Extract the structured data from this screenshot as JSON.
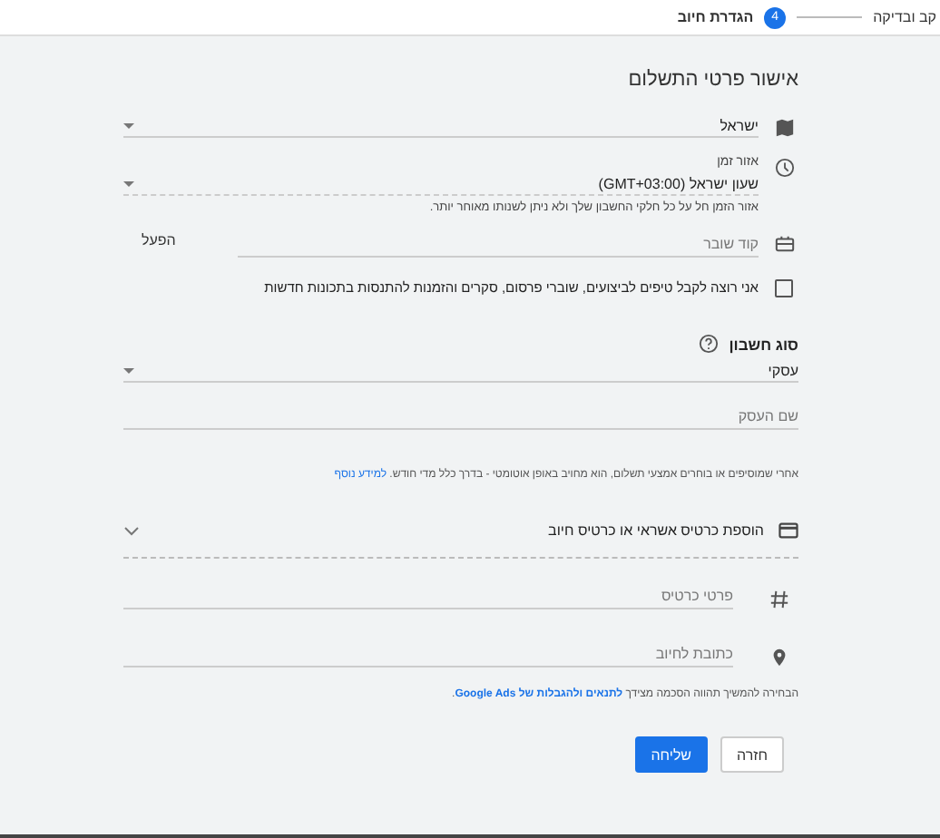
{
  "stepper": {
    "steps": [
      {
        "label": "קב ובדיקה",
        "selected": false
      },
      {
        "label": "הגדרת חיוב",
        "number": "4",
        "selected": true
      }
    ]
  },
  "title": "אישור פרטי התשלום",
  "country": {
    "value": "ישראל"
  },
  "timezone": {
    "label": "אזור זמן",
    "value": "שעון ישראל (GMT+03:00)",
    "help": "אזור הזמן חל על כל חלקי החשבון שלך ולא ניתן לשנותו מאוחר יותר."
  },
  "promo": {
    "placeholder": "קוד שובר",
    "button": "הפעל"
  },
  "tips_checkbox": {
    "label": "אני רוצה לקבל טיפים לביצועים, שוברי פרסום, סקרים והזמנות להתנסות בתכונות חדשות",
    "checked": false
  },
  "account_type": {
    "label": "סוג חשבון",
    "value": "עסקי"
  },
  "business_name": {
    "placeholder": "שם העסק"
  },
  "payment_note": {
    "text": "אחרי שמוסיפים או בוחרים אמצעי תשלום, הוא מחויב באופן אוטומטי - בדרך כלל מדי חודש.",
    "link": "למידע נוסף"
  },
  "card_section": {
    "title": "הוספת כרטיס אשראי או כרטיס חיוב",
    "expanded": true
  },
  "card_fields": [
    {
      "kind": "card",
      "placeholder": "פרטי כרטיס"
    },
    {
      "kind": "address",
      "placeholder": "כתובת לחיוב"
    }
  ],
  "terms": {
    "before": "הבחירה להמשיך תהווה הסכמה מצידך ",
    "link": "לתנאים ולהגבלות של Google Ads",
    "after": "."
  },
  "buttons": [
    {
      "kind": "secondary",
      "label": "חזרה"
    },
    {
      "kind": "primary",
      "label": "שליחה"
    }
  ]
}
